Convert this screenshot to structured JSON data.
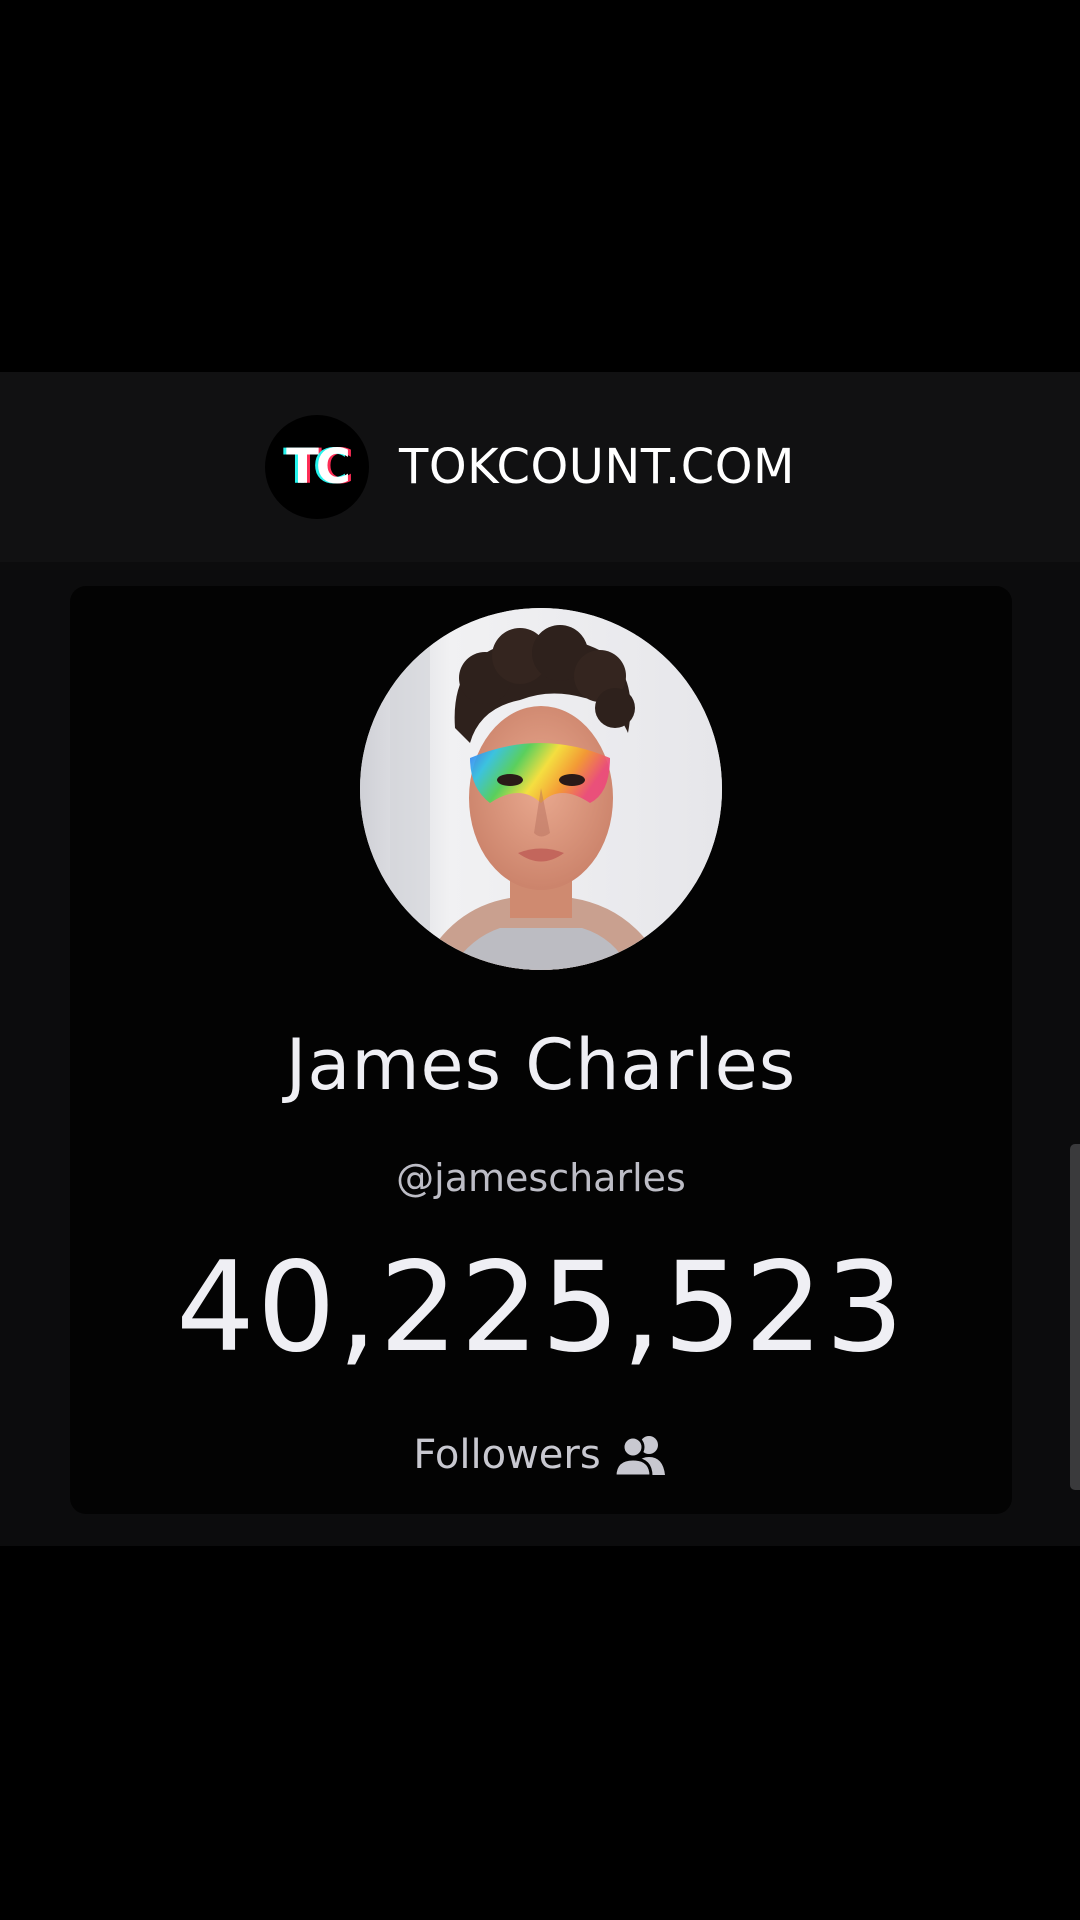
{
  "header": {
    "logo_icon": "tokcount-logo-icon",
    "logo_alt": "TC",
    "site_name": "TOKCOUNT.COM"
  },
  "profile": {
    "avatar_icon": "profile-photo",
    "display_name": "James Charles",
    "handle": "@jamescharles",
    "follower_count": "40,225,523",
    "followers_label": "Followers",
    "followers_icon": "users-icon"
  },
  "colors": {
    "background": "#000000",
    "header_bar": "#111112",
    "card": "#030303",
    "text_primary": "#efeff4",
    "text_secondary": "#bdbdc6",
    "logo_accent_cyan": "#25f4ee",
    "logo_accent_red": "#fe2c55"
  }
}
